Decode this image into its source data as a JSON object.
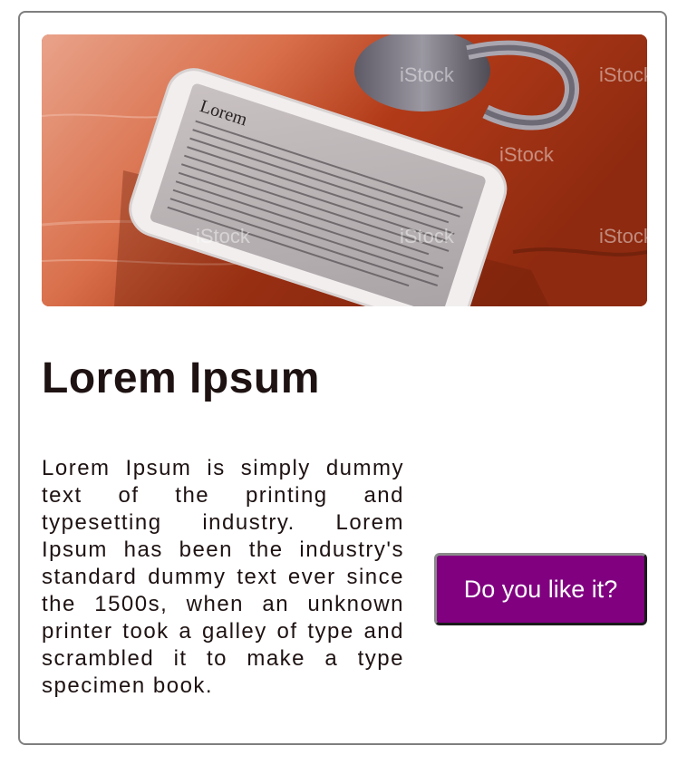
{
  "card": {
    "image": {
      "watermark": "iStock",
      "screen_heading": "Lorem"
    },
    "title": "Lorem Ipsum",
    "description": "Lorem Ipsum is simply dummy text of the printing and typesetting industry. Lorem Ipsum has been the industry's standard dummy text ever since the 1500s, when an unknown printer took a galley of type and scrambled it to make a type specimen book.",
    "button_label": "Do you like it?"
  },
  "colors": {
    "button_bg": "#800080",
    "button_text": "#ffffff",
    "text": "#1e1212",
    "card_border": "#7f7f7f"
  }
}
